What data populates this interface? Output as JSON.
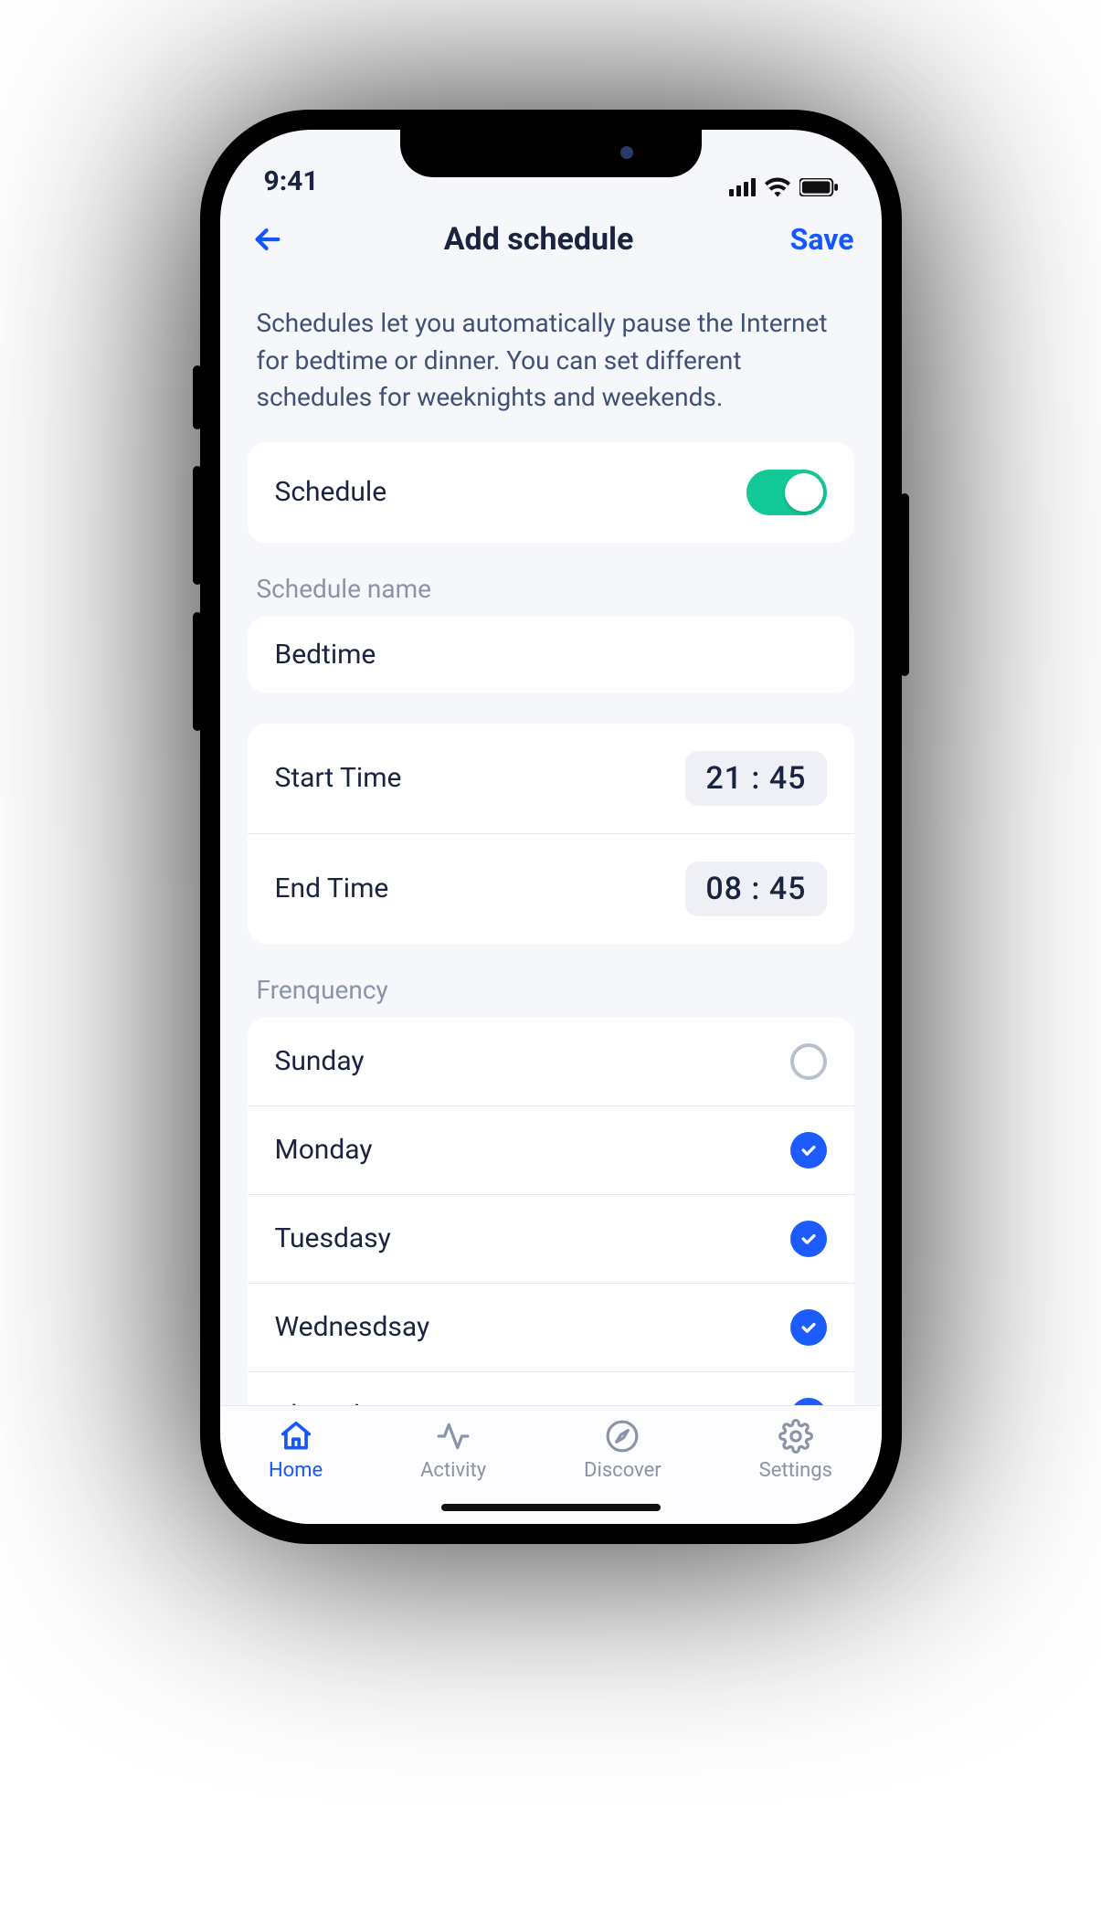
{
  "status": {
    "time": "9:41"
  },
  "header": {
    "title": "Add schedule",
    "save": "Save"
  },
  "description": "Schedules let you automatically pause the Internet for bedtime or dinner. You can set different schedules for weeknights and weekends.",
  "schedule_toggle": {
    "label": "Schedule",
    "on": true
  },
  "name_section": {
    "label": "Schedule name",
    "value": "Bedtime"
  },
  "time": {
    "start_label": "Start Time",
    "start_value": "21 : 45",
    "end_label": "End Time",
    "end_value": "08 : 45"
  },
  "frequency": {
    "label": "Frenquency",
    "days": [
      {
        "name": "Sunday",
        "checked": false
      },
      {
        "name": "Monday",
        "checked": true
      },
      {
        "name": "Tuesdasy",
        "checked": true
      },
      {
        "name": "Wednesdsay",
        "checked": true
      },
      {
        "name": "Thursday",
        "checked": true
      }
    ]
  },
  "tabs": {
    "home": "Home",
    "activity": "Activity",
    "discover": "Discover",
    "settings": "Settings"
  }
}
